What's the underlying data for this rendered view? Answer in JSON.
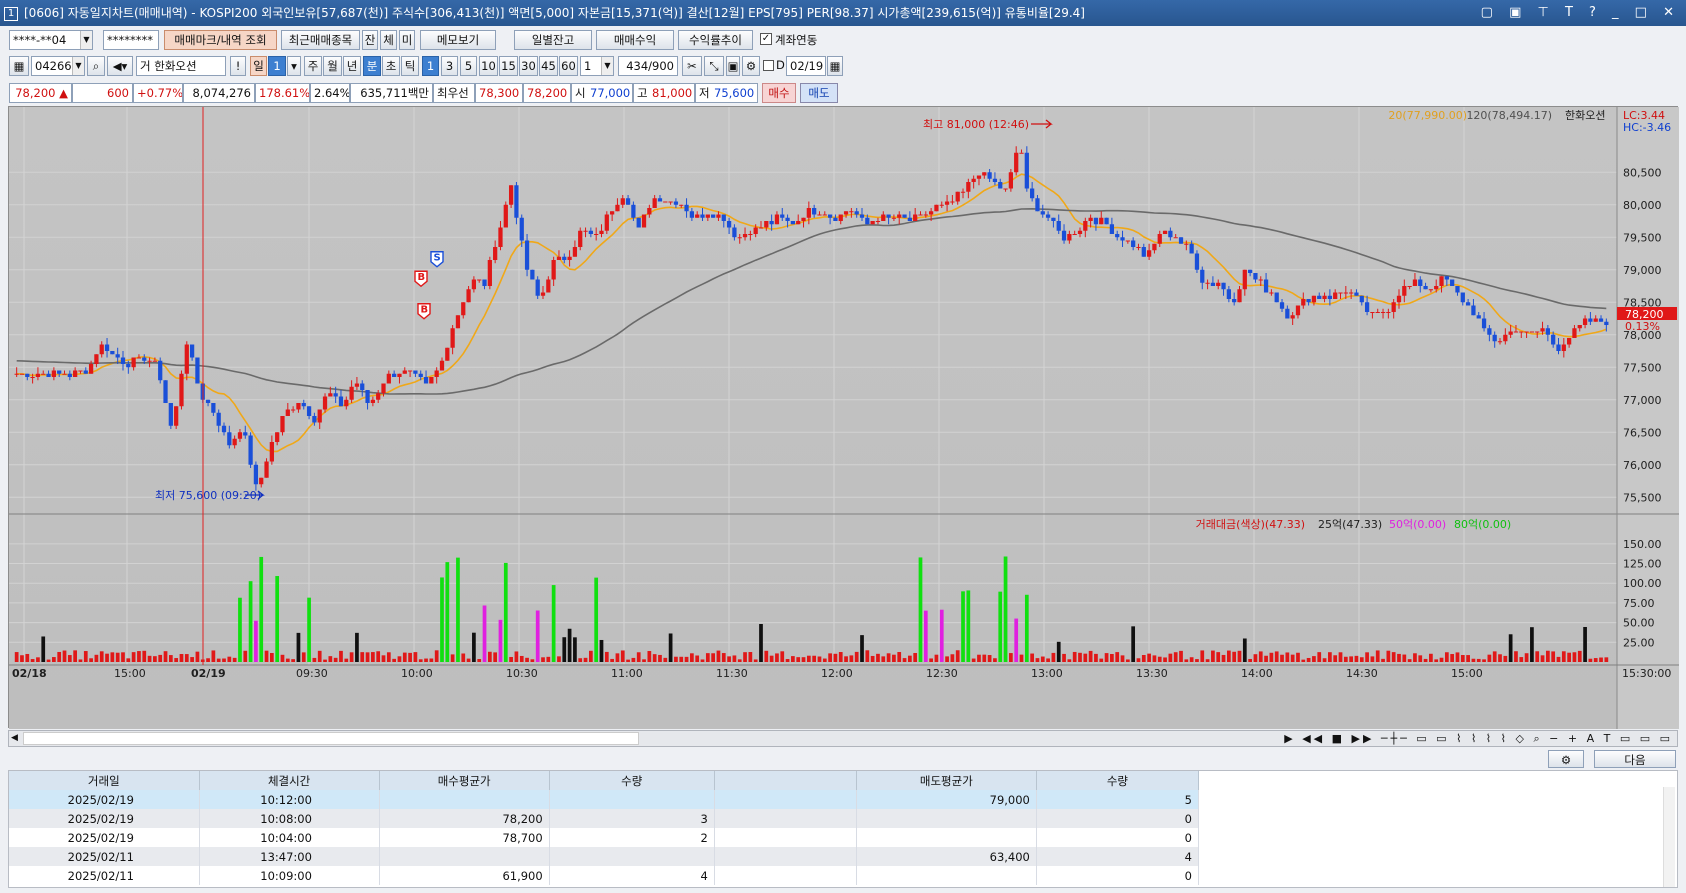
{
  "window": {
    "title": "[0606] 자동일지차트(매매내역) - KOSPI200 외국인보유[57,687(천)] 주식수[306,413(천)] 액면[5,000] 자본금[15,371(억)] 결산[12월] EPS[795] PER[98.37] 시가총액[239,615(억)] 유통비율[29.4]",
    "number": "1",
    "controls": "▢ ▣ ⊤ T ? _ □ ✕"
  },
  "toolbar1": {
    "account": "****-**04",
    "password": "********",
    "trade_mark_btn": "매매마크/내역 조회",
    "recent_btn": "최근매매종목",
    "jan": "잔",
    "che": "체",
    "mi": "미",
    "memo_btn": "메모보기",
    "daily_balance_btn": "일별잔고",
    "trade_profit_btn": "매매수익",
    "return_trend_btn": "수익률추이",
    "account_link_label": "계좌연동"
  },
  "toolbar2": {
    "code": "042660",
    "stock_prefix": "거",
    "stock_name": "한화오션",
    "excl": "!",
    "period_il": "일",
    "period_val": "1",
    "ju": "주",
    "wol": "월",
    "nyeon": "년",
    "bun": "분",
    "cho": "초",
    "tik": "틱",
    "intervals": [
      "1",
      "3",
      "5",
      "10",
      "15",
      "30",
      "45",
      "60"
    ],
    "interval_input": "1",
    "count": "434",
    "count_max": "/900",
    "d_label": "D",
    "date": "02/19"
  },
  "quote": {
    "price": "78,200",
    "arrow": "▲",
    "change": "600",
    "change_pct": "+0.77%",
    "volume": "8,074,276",
    "vol_ratio": "178.61%",
    "turnover": "2.64%",
    "amount": "635,711백만",
    "best_label": "최우선",
    "best_ask": "78,300",
    "best_bid": "78,200",
    "open_label": "시",
    "open": "77,000",
    "high_label": "고",
    "high": "81,000",
    "low_label": "저",
    "low": "75,600",
    "buy_btn": "매수",
    "sell_btn": "매도"
  },
  "chart_data": {
    "type": "candlestick",
    "legend": {
      "ma20": "20(77,990.00)",
      "ma120": "120(78,494.17)",
      "name": "한화오션",
      "lc": "LC:3.44",
      "hc": "HC:-3.46"
    },
    "ylim": [
      75350,
      81350
    ],
    "yticks": [
      "80,500",
      "80,000",
      "79,500",
      "79,000",
      "78,500",
      "78,000",
      "77,500",
      "77,000",
      "76,500",
      "76,000",
      "75,500"
    ],
    "current_price": "78,200",
    "current_pct": "0.13%",
    "high_annotation": "최고 81,000 (12:46)",
    "low_annotation": "최저 75,600 (09:20)",
    "trade_marks": [
      {
        "label": "S",
        "time": "10:12",
        "price": 79000
      },
      {
        "label": "B",
        "time": "10:08",
        "price": 78200
      },
      {
        "label": "B",
        "time": "10:04",
        "price": 78700
      }
    ],
    "volume_panel": {
      "legend_title": "거래대금(색상)(47.33)",
      "l25": "25억(47.33)",
      "l50": "50억(0.00)",
      "l80": "80억(0.00)",
      "ylim": [
        0,
        165
      ],
      "yticks": [
        "150.00",
        "125.00",
        "100.00",
        "75.00",
        "50.00",
        "25.00"
      ]
    },
    "xticks": [
      "02/18",
      "15:00",
      "02/19",
      "09:30",
      "10:00",
      "10:30",
      "11:00",
      "11:30",
      "12:00",
      "12:30",
      "13:00",
      "13:30",
      "14:00",
      "14:30",
      "15:00"
    ],
    "x_end_label": "15:30:00",
    "price_path": [
      [
        0,
        77400
      ],
      [
        8,
        77400
      ],
      [
        10,
        77450
      ],
      [
        12,
        77850
      ],
      [
        14,
        77650
      ],
      [
        16,
        77550
      ],
      [
        18,
        77650
      ],
      [
        20,
        77500
      ],
      [
        22,
        76500
      ],
      [
        24,
        77900
      ],
      [
        26,
        77100
      ],
      [
        28,
        76800
      ],
      [
        30,
        76300
      ],
      [
        32,
        76600
      ],
      [
        34,
        75600
      ],
      [
        36,
        76300
      ],
      [
        38,
        76800
      ],
      [
        40,
        77000
      ],
      [
        42,
        76700
      ],
      [
        44,
        77100
      ],
      [
        46,
        76900
      ],
      [
        48,
        77300
      ],
      [
        50,
        76900
      ],
      [
        52,
        77300
      ],
      [
        54,
        77450
      ],
      [
        56,
        77400
      ],
      [
        58,
        77200
      ],
      [
        60,
        77500
      ],
      [
        61,
        77900
      ],
      [
        63,
        78500
      ],
      [
        65,
        78900
      ],
      [
        66,
        78700
      ],
      [
        68,
        79500
      ],
      [
        70,
        80300
      ],
      [
        72,
        79100
      ],
      [
        74,
        78500
      ],
      [
        76,
        79100
      ],
      [
        78,
        79200
      ],
      [
        80,
        79600
      ],
      [
        82,
        79500
      ],
      [
        84,
        79900
      ],
      [
        86,
        80200
      ],
      [
        88,
        79600
      ],
      [
        90,
        80100
      ],
      [
        92,
        80100
      ],
      [
        94,
        80000
      ],
      [
        96,
        79800
      ],
      [
        98,
        79900
      ],
      [
        100,
        79800
      ],
      [
        102,
        79500
      ],
      [
        104,
        79600
      ],
      [
        106,
        79700
      ],
      [
        108,
        79800
      ],
      [
        110,
        79700
      ],
      [
        112,
        79900
      ],
      [
        114,
        79900
      ],
      [
        116,
        79800
      ],
      [
        118,
        79950
      ],
      [
        120,
        79700
      ],
      [
        122,
        79800
      ],
      [
        124,
        79800
      ],
      [
        126,
        79750
      ],
      [
        128,
        79800
      ],
      [
        130,
        79950
      ],
      [
        132,
        80000
      ],
      [
        134,
        80200
      ],
      [
        136,
        80500
      ],
      [
        138,
        80400
      ],
      [
        140,
        80200
      ],
      [
        142,
        81000
      ],
      [
        143,
        80200
      ],
      [
        144,
        80000
      ],
      [
        146,
        79800
      ],
      [
        148,
        79500
      ],
      [
        150,
        79600
      ],
      [
        152,
        79800
      ],
      [
        154,
        79700
      ],
      [
        156,
        79500
      ],
      [
        158,
        79400
      ],
      [
        160,
        79200
      ],
      [
        162,
        79600
      ],
      [
        164,
        79500
      ],
      [
        166,
        79300
      ],
      [
        168,
        78800
      ],
      [
        170,
        78800
      ],
      [
        172,
        78500
      ],
      [
        174,
        79000
      ],
      [
        176,
        78800
      ],
      [
        178,
        78600
      ],
      [
        180,
        78300
      ],
      [
        182,
        78500
      ],
      [
        184,
        78600
      ],
      [
        186,
        78600
      ],
      [
        188,
        78700
      ],
      [
        190,
        78500
      ],
      [
        192,
        78300
      ],
      [
        194,
        78400
      ],
      [
        196,
        78700
      ],
      [
        198,
        78800
      ],
      [
        200,
        78700
      ],
      [
        202,
        78900
      ],
      [
        204,
        78600
      ],
      [
        206,
        78400
      ],
      [
        208,
        78000
      ],
      [
        210,
        77900
      ],
      [
        212,
        78100
      ],
      [
        214,
        78000
      ],
      [
        216,
        78100
      ],
      [
        218,
        77800
      ],
      [
        220,
        78000
      ],
      [
        222,
        78200
      ],
      [
        224,
        78200
      ],
      [
        225,
        78200
      ]
    ]
  },
  "trade_table": {
    "headers": [
      "거래일",
      "체결시간",
      "매수평균가",
      "수량",
      "",
      "매도평균가",
      "수량"
    ],
    "rows": [
      {
        "date": "2025/02/19",
        "time": "10:12:00",
        "buy_avg": "",
        "buy_qty": "",
        "sell_avg": "79,000",
        "sell_qty": "5"
      },
      {
        "date": "2025/02/19",
        "time": "10:08:00",
        "buy_avg": "78,200",
        "buy_qty": "3",
        "sell_avg": "",
        "sell_qty": "0"
      },
      {
        "date": "2025/02/19",
        "time": "10:04:00",
        "buy_avg": "78,700",
        "buy_qty": "2",
        "sell_avg": "",
        "sell_qty": "0"
      },
      {
        "date": "2025/02/11",
        "time": "13:47:00",
        "buy_avg": "",
        "buy_qty": "",
        "sell_avg": "63,400",
        "sell_qty": "4"
      },
      {
        "date": "2025/02/11",
        "time": "10:09:00",
        "buy_avg": "61,900",
        "buy_qty": "4",
        "sell_avg": "",
        "sell_qty": "0"
      }
    ],
    "next_btn": "다음"
  }
}
